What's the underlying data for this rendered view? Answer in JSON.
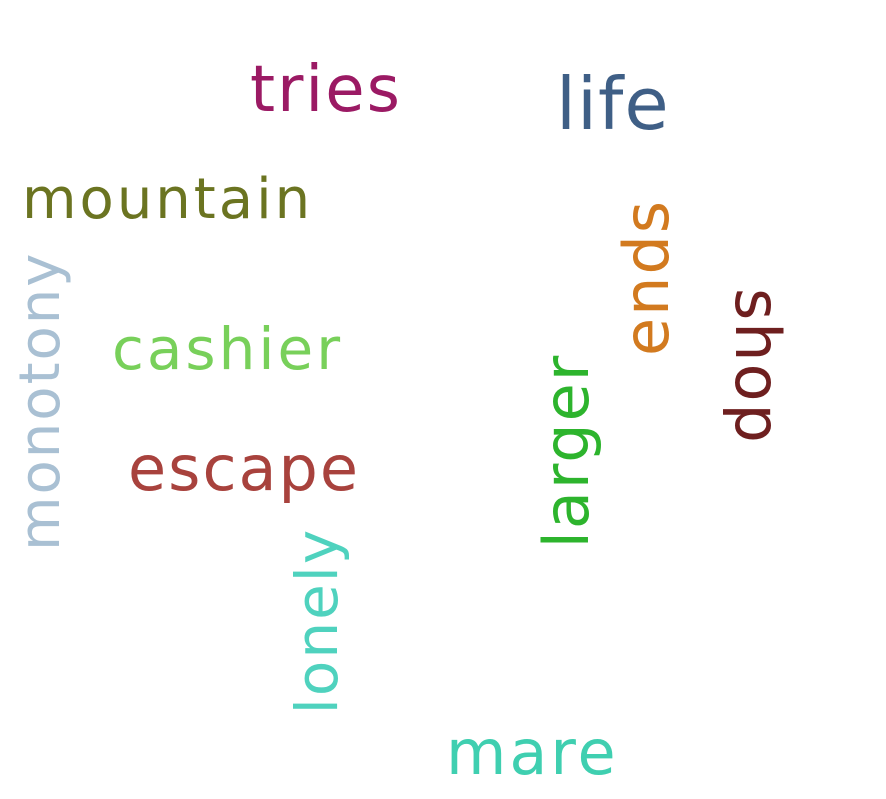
{
  "words": {
    "tries": {
      "text": "tries",
      "color": "#9b1a64"
    },
    "life": {
      "text": "life",
      "color": "#3f5f86"
    },
    "mountain": {
      "text": "mountain",
      "color": "#6b7421"
    },
    "monotony": {
      "text": "monotony",
      "color": "#a9c0d3"
    },
    "cashier": {
      "text": "cashier",
      "color": "#78d05a"
    },
    "escape": {
      "text": "escape",
      "color": "#a8423d"
    },
    "lonely": {
      "text": "lonely",
      "color": "#4fd2be"
    },
    "larger": {
      "text": "larger",
      "color": "#2db42d"
    },
    "ends": {
      "text": "ends",
      "color": "#d27a1f"
    },
    "shop": {
      "text": "shop",
      "color": "#6e1f1f"
    },
    "mare": {
      "text": "mare",
      "color": "#3fcfb0"
    }
  }
}
